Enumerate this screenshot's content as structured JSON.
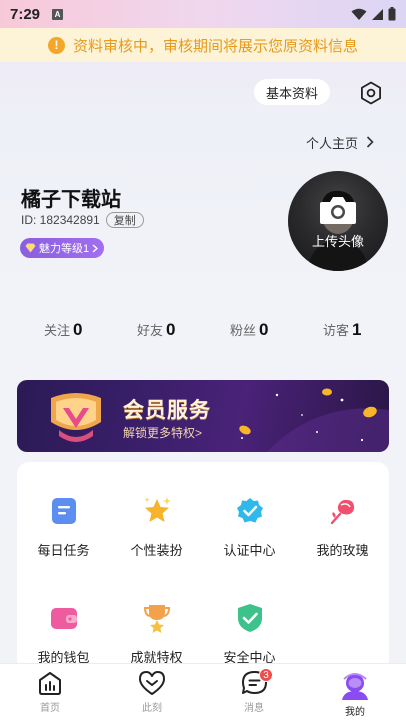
{
  "status_bar": {
    "time": "7:29",
    "indicator": "A"
  },
  "notice": {
    "text": "资料审核中，审核期间将展示您原资料信息",
    "icon": "alert-icon",
    "color": "#e79a1d"
  },
  "header": {
    "basic_info_label": "基本资料",
    "settings_icon": "gear-icon",
    "homepage_label": "个人主页"
  },
  "profile": {
    "name": "橘子下载站",
    "id_text": "ID: 182342891",
    "copy_label": "复制",
    "charm_label": "魅力等级1",
    "avatar_label": "上传头像"
  },
  "stats": [
    {
      "label": "关注",
      "value": "0"
    },
    {
      "label": "好友",
      "value": "0"
    },
    {
      "label": "粉丝",
      "value": "0"
    },
    {
      "label": "访客",
      "value": "1"
    }
  ],
  "vip": {
    "title": "会员服务",
    "subtitle": "解锁更多特权>"
  },
  "grid": [
    {
      "label": "每日任务",
      "icon": "task-icon",
      "color": "#5b8ef0"
    },
    {
      "label": "个性装扮",
      "icon": "star-icon",
      "color": "#f6b32b"
    },
    {
      "label": "认证中心",
      "icon": "verified-icon",
      "color": "#2fb8ec"
    },
    {
      "label": "我的玫瑰",
      "icon": "rose-icon",
      "color": "#f0506e"
    },
    {
      "label": "我的钱包",
      "icon": "wallet-icon",
      "color": "#ee5b9e"
    },
    {
      "label": "成就特权",
      "icon": "trophy-icon",
      "color": "#f2a24a"
    },
    {
      "label": "安全中心",
      "icon": "shield-icon",
      "color": "#3cc28a"
    }
  ],
  "nav": [
    {
      "label": "首页",
      "icon": "home-icon"
    },
    {
      "label": "此刻",
      "icon": "heart-icon"
    },
    {
      "label": "消息",
      "icon": "message-icon",
      "badge": "3"
    },
    {
      "label": "我的",
      "icon": "profile-icon",
      "active": true
    }
  ]
}
